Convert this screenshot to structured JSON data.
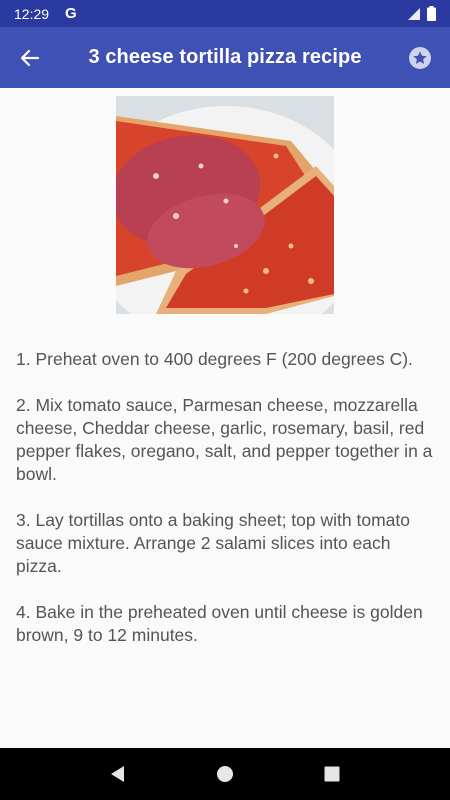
{
  "status_bar": {
    "time": "12:29",
    "g_letter": "G"
  },
  "app_bar": {
    "title": "3 cheese tortilla pizza recipe",
    "back_icon": "arrow-back-icon",
    "favorite_icon": "star-icon"
  },
  "recipe": {
    "image_alt": "tortilla pizza with salami",
    "steps": [
      "1. Preheat oven to 400 degrees F (200 degrees C).",
      "2. Mix tomato sauce, Parmesan cheese, mozzarella cheese, Cheddar cheese, garlic, rosemary, basil, red pepper flakes, oregano, salt, and pepper together in a bowl.",
      "3. Lay tortillas onto a baking sheet; top with tomato sauce mixture. Arrange 2 salami slices into each pizza.",
      "4. Bake in the preheated oven until cheese is golden brown, 9 to 12 minutes."
    ]
  },
  "nav_bar": {
    "back_icon": "triangle-back-icon",
    "home_icon": "circle-home-icon",
    "recents_icon": "square-recents-icon"
  },
  "colors": {
    "primary": "#3f51b5",
    "primary_dark": "#2b3aa0",
    "text": "#555555"
  }
}
